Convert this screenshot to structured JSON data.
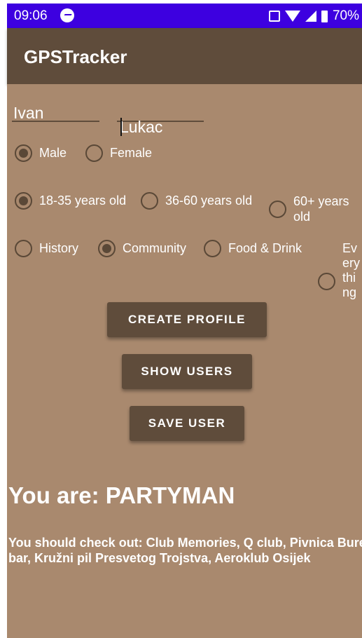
{
  "status_bar": {
    "time": "09:06",
    "battery": "70%",
    "icons": [
      "messenger-icon",
      "vibrate-icon",
      "wifi-icon",
      "cell-signal-icon",
      "battery-icon"
    ]
  },
  "app": {
    "title": "GPSTracker"
  },
  "form": {
    "first_name": "Ivan",
    "last_name": "Lukac",
    "gender": {
      "options": [
        "Male",
        "Female"
      ],
      "selected": "Male"
    },
    "age": {
      "options": [
        "18-35 years old",
        "36-60 years old",
        "60+ years old"
      ],
      "selected": "18-35 years old"
    },
    "interest": {
      "options": [
        "History",
        "Community",
        "Food & Drink",
        "Everything"
      ],
      "selected": "Community"
    }
  },
  "buttons": {
    "create_profile": "CREATE PROFILE",
    "show_users": "SHOW USERS",
    "save_user": "SAVE USER"
  },
  "result": {
    "title": "You are: PARTYMAN",
    "recommendation": "You should check out: Club Memories, Q club, Pivnica Bure bar, Kružni pil Presvetog Trojstva, Aeroklub Osijek"
  },
  "colors": {
    "status_bar": "#3d00e0",
    "app_bar": "#5f4c3b",
    "background": "#a9896e",
    "radio": "#5a4837",
    "button": "#5f4c3b"
  }
}
